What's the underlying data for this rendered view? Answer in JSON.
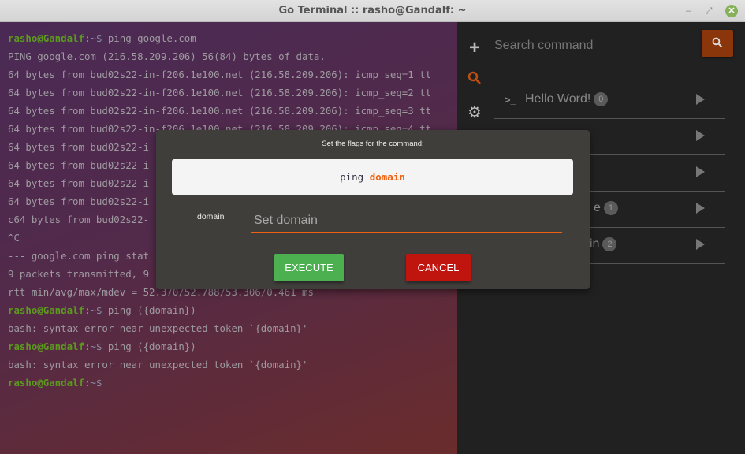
{
  "window": {
    "title": "Go Terminal :: rasho@Gandalf: ~",
    "minimize": "–",
    "maximize": "⤢",
    "close": "✕"
  },
  "terminal": {
    "prompt_user": "rasho@Gandalf",
    "prompt_path": ":~$",
    "lines": [
      {
        "prompt": true,
        "text": " ping google.com"
      },
      {
        "text": "PING google.com (216.58.209.206) 56(84) bytes of data."
      },
      {
        "text": "64 bytes from bud02s22-in-f206.1e100.net (216.58.209.206): icmp_seq=1 tt"
      },
      {
        "text": "64 bytes from bud02s22-in-f206.1e100.net (216.58.209.206): icmp_seq=2 tt"
      },
      {
        "text": "64 bytes from bud02s22-in-f206.1e100.net (216.58.209.206): icmp_seq=3 tt"
      },
      {
        "text": "64 bytes from bud02s22-in-f206.1e100.net (216.58.209.206): icmp_seq=4 tt"
      },
      {
        "text": "64 bytes from bud02s22-i"
      },
      {
        "text": "64 bytes from bud02s22-i"
      },
      {
        "text": "64 bytes from bud02s22-i"
      },
      {
        "text": "64 bytes from bud02s22-i"
      },
      {
        "text": "c64 bytes from bud02s22-"
      },
      {
        "text": "^C"
      },
      {
        "text": "--- google.com ping stat"
      },
      {
        "text": "9 packets transmitted, 9"
      },
      {
        "text": "rtt min/avg/max/mdev = 52.370/52.788/53.306/0.461 ms"
      },
      {
        "prompt": true,
        "text": " ping ({domain})"
      },
      {
        "text": "bash: syntax error near unexpected token `{domain}'"
      },
      {
        "prompt": true,
        "text": " ping ({domain})"
      },
      {
        "text": "bash: syntax error near unexpected token `{domain}'"
      },
      {
        "prompt": true,
        "text": ""
      }
    ]
  },
  "sidebar": {
    "icons": [
      "plus-icon",
      "search-icon",
      "gear-icon"
    ],
    "active": "search-icon",
    "accent": "#c0500f"
  },
  "search": {
    "placeholder": "Search command",
    "button_icon": "search-icon",
    "button_color": "#8a360a"
  },
  "commands": [
    {
      "label": "Hello Word!",
      "count": "0"
    },
    {
      "label": "",
      "count": ""
    },
    {
      "label": "",
      "count": ""
    },
    {
      "label": "e",
      "count": "1"
    },
    {
      "label": "in",
      "count": "2"
    }
  ],
  "modal": {
    "title": "Set the flags for the command:",
    "command": "ping",
    "argument": "domain",
    "flag_label": "domain",
    "flag_placeholder": "Set domain",
    "flag_value": "",
    "execute_label": "EXECUTE",
    "cancel_label": "CANCEL",
    "execute_color": "#4caf50",
    "cancel_color": "#c0140f"
  }
}
